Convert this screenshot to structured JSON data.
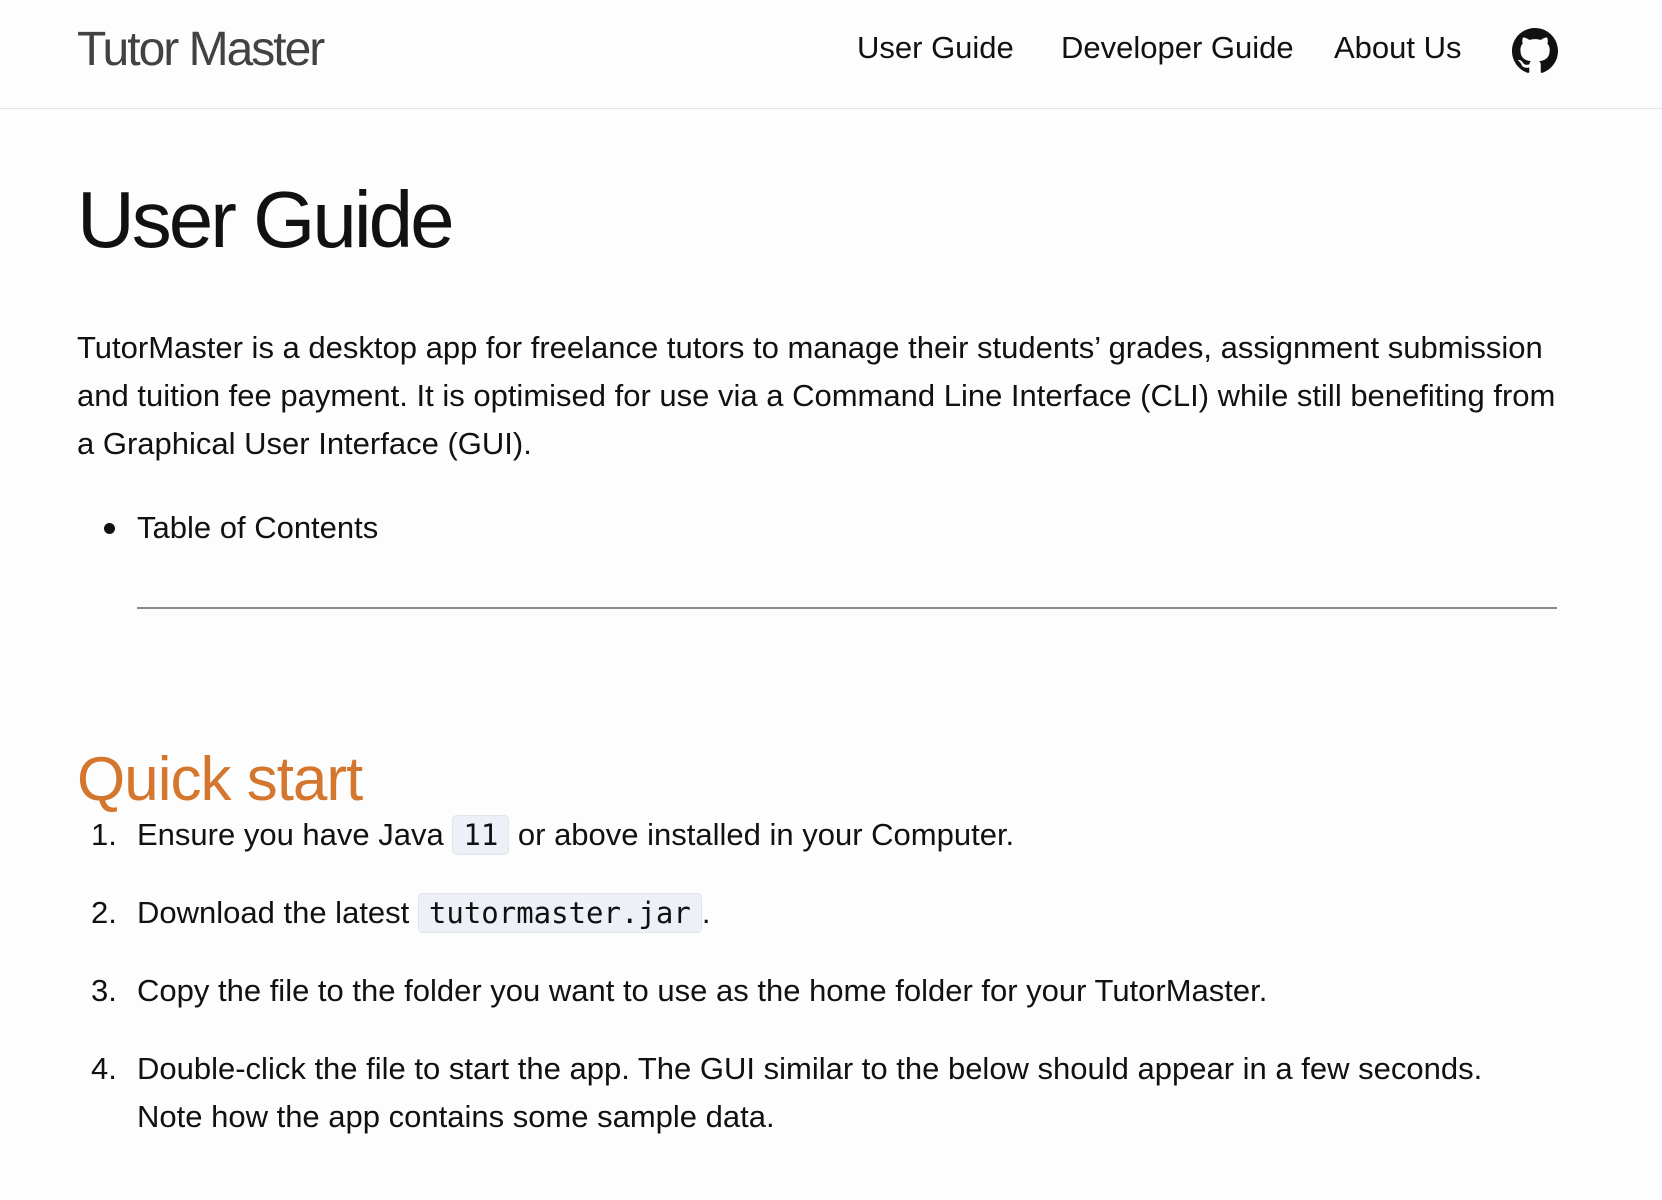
{
  "header": {
    "site_title": "Tutor Master",
    "nav": [
      "User Guide",
      "Developer Guide",
      "About Us"
    ],
    "github_icon": "github-icon"
  },
  "main": {
    "title": "User Guide",
    "intro": "TutorMaster is a desktop app for freelance tutors to manage their students’ grades, assignment submission and tuition fee payment. It is optimised for use via a Command Line Interface (CLI) while still benefiting from a Graphical User Interface (GUI).",
    "toc_label": "Table of Contents",
    "quick_start": {
      "heading": "Quick start",
      "steps": [
        {
          "num": "1.",
          "before": "Ensure you have Java ",
          "code": "11",
          "after": " or above installed in your Computer."
        },
        {
          "num": "2.",
          "before": "Download the latest ",
          "code": "tutormaster.jar",
          "after": "."
        },
        {
          "num": "3.",
          "text": "Copy the file to the folder you want to use as the home folder for your TutorMaster."
        },
        {
          "num": "4.",
          "text": "Double-click the file to start the app. The GUI similar to the below should appear in a few seconds. Note how the app contains some sample data."
        }
      ]
    }
  }
}
